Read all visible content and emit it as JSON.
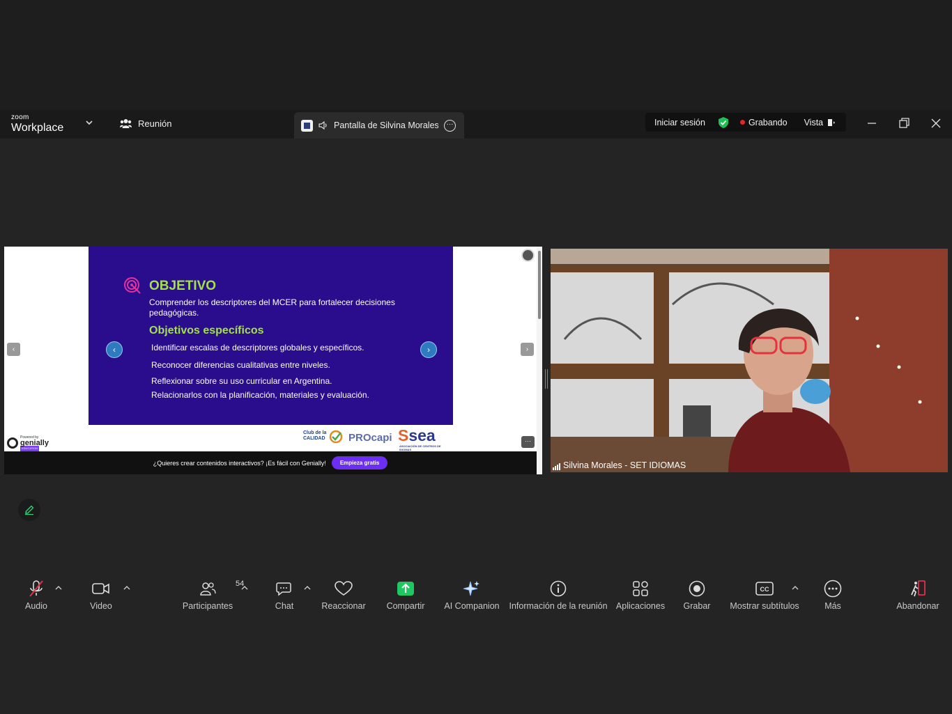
{
  "titlebar": {
    "logo_top": "zoom",
    "logo_bottom": "Workplace",
    "meeting_tab": "Reunión",
    "share_tab_title": "Pantalla de Silvina Morales - SET IDIOMAS",
    "signin": "Iniciar sesión",
    "recording": "Grabando",
    "view": "Vista"
  },
  "slide": {
    "title": "OBJETIVO",
    "description": "Comprender los descriptores del MCER para fortalecer decisiones pedagógicas.",
    "subtitle": "Objetivos específicos",
    "bullets": [
      "Identificar escalas de descriptores globales y específicos.",
      "Reconocer diferencias cualitativas entre niveles.",
      "Reflexionar sobre su uso curricular en Argentina.",
      "Relacionarlos con la planificación, materiales y evaluación."
    ],
    "logos": {
      "club1": "Club de la",
      "club2": "CALIDAD",
      "procapi": "PROcapi",
      "sea": "sea",
      "sea_sub": "ASOCIACIÓN DE CENTROS DE IDIOMAS"
    },
    "powered_by": "Powered by",
    "genially": "genially",
    "genially_tag": "EDUCATION",
    "promo_text": "¿Quieres crear contenidos interactivos? ¡Es fácil con Genially!",
    "promo_cta": "Empieza gratis"
  },
  "video": {
    "participant_name": "Silvina Morales - SET IDIOMAS"
  },
  "toolbar": {
    "audio": "Audio",
    "video": "Video",
    "participants": "Participantes",
    "participants_count": "54",
    "chat": "Chat",
    "react": "Reaccionar",
    "share": "Compartir",
    "ai": "AI Companion",
    "info": "Información de la reunión",
    "apps": "Aplicaciones",
    "record": "Grabar",
    "captions": "Mostrar subtítulos",
    "more": "Más",
    "leave": "Abandonar"
  },
  "colors": {
    "slide_bg": "#2a0d8c",
    "slide_accent": "#a3e04a",
    "share_green": "#1ec760",
    "leave_red": "#e0324b",
    "genially_purple": "#6c2ff2"
  }
}
